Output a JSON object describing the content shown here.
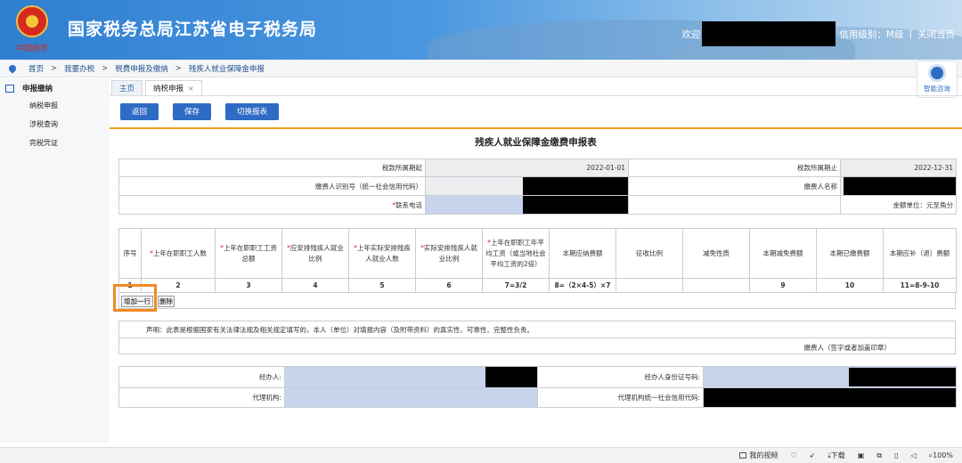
{
  "header": {
    "site_title": "国家税务总局江苏省电子税务局",
    "emblem_text": "中国税务",
    "welcome": "欢迎",
    "credit_level": "信用级别：M级",
    "close_link": "关闭当页"
  },
  "breadcrumb": [
    "首页",
    "我要办税",
    "税费申报及缴纳",
    "残疾人就业保障金申报"
  ],
  "help": {
    "label": "智能咨询"
  },
  "sidebar": {
    "section": "申报缴纳",
    "items": [
      "纳税申报",
      "涉税查询",
      "完税凭证"
    ]
  },
  "tabs": [
    {
      "label": "主页"
    },
    {
      "label": "纳税申报",
      "close": "×"
    }
  ],
  "toolbar": {
    "back": "返回",
    "save": "保存",
    "switch": "切换报表"
  },
  "form": {
    "title": "残疾人就业保障金缴费申报表",
    "period_start_label": "税款所属期起",
    "period_start": "2022-01-01",
    "period_end_label": "税款所属期止",
    "period_end": "2022-12-31",
    "payer_id_label": "缴费人识别号（统一社会信用代码）",
    "payer_name_label": "缴费人名称",
    "phone_label": "联系电话",
    "currency_unit": "金额单位：元至角分"
  },
  "grid": {
    "headers": [
      {
        "text": "序号",
        "req": false
      },
      {
        "text": "上年在职职工人数",
        "req": true
      },
      {
        "text": "上年在职职工工资总额",
        "req": true
      },
      {
        "text": "应安排残疾人就业比例",
        "req": true
      },
      {
        "text": "上年实际安排残疾人就业人数",
        "req": true
      },
      {
        "text": "实际安排残疾人就业比例",
        "req": true
      },
      {
        "text": "上年在职职工年平均工资（或当地社会平均工资的2倍）",
        "req": true
      },
      {
        "text": "本期应纳费额",
        "req": false
      },
      {
        "text": "征收比例",
        "req": false
      },
      {
        "text": "减免性质",
        "req": false
      },
      {
        "text": "本期减免费额",
        "req": false
      },
      {
        "text": "本期已缴费额",
        "req": false
      },
      {
        "text": "本期应补（退）费额",
        "req": false
      }
    ],
    "row_numbers": [
      "1",
      "2",
      "3",
      "4",
      "5",
      "6",
      "7=3/2",
      "8=（2×4-5）×7",
      "",
      "",
      "9",
      "10",
      "11=8-9-10"
    ],
    "add_row": "增加一行",
    "delete_row": "删除"
  },
  "declaration": {
    "text": "声明：此表是根据国家有关法律法规及相关规定填写的，本人（单位）对填报内容（及附带资料）的真实性、可靠性、完整性负责。",
    "signature": "缴费人（签字或者加盖印章）"
  },
  "agent": {
    "handler_label": "经办人:",
    "handler_id_label": "经办人身份证号码:",
    "agency_label": "代理机构:",
    "agency_code_label": "代理机构统一社会信用代码:"
  },
  "statusbar": [
    "我的视频",
    "下载",
    "100%"
  ]
}
